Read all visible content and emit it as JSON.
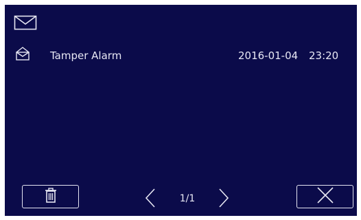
{
  "header": {
    "icon": "envelope-icon"
  },
  "messages": [
    {
      "icon": "envelope-open-icon",
      "title": "Tamper Alarm",
      "date": "2016-01-04",
      "time": "23:20"
    }
  ],
  "footer": {
    "delete_icon": "trash-icon",
    "prev_icon": "chevron-left-icon",
    "page": "1/1",
    "next_icon": "chevron-right-icon",
    "close_icon": "close-icon"
  },
  "colors": {
    "background": "#0b0b4a",
    "foreground": "#e8e8f4"
  }
}
